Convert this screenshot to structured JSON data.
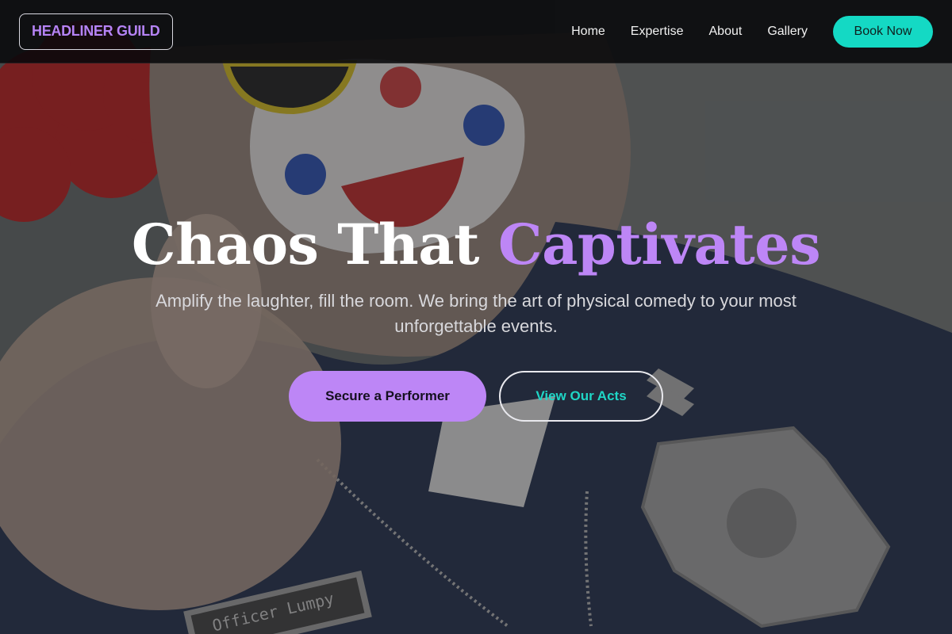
{
  "nav": {
    "logo": "HEADLINER GUILD",
    "links": [
      "Home",
      "Expertise",
      "About",
      "Gallery"
    ],
    "cta": "Book Now"
  },
  "hero": {
    "headline_plain": "Chaos That",
    "headline_accent": "Captivates",
    "subhead": "Amplify the laughter, fill the room. We bring the art of physical comedy to your most unforgettable events.",
    "primary_cta": "Secure a Performer",
    "secondary_cta": "View Our Acts",
    "name_tag": "Officer Lumpy"
  },
  "colors": {
    "accent_purple": "#bd86f6",
    "accent_teal": "#14d9c4",
    "nav_bg": "#08080a"
  }
}
